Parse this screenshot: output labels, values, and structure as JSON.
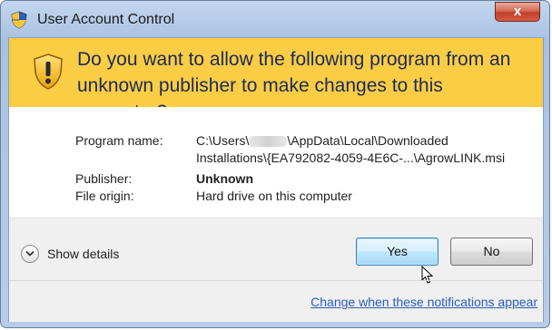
{
  "window": {
    "title": "User Account Control",
    "close_label": "x"
  },
  "banner": {
    "question": "Do you want to allow the following program from an unknown publisher to make changes to this computer?"
  },
  "details": {
    "program_name_label": "Program name:",
    "program_path_line1_prefix": "C:\\Users\\",
    "program_path_line1_suffix": "\\AppData\\Local\\Downloaded",
    "program_path_line2": "Installations\\{EA792082-4059-4E6C-...\\AgrowLINK.msi",
    "publisher_label": "Publisher:",
    "publisher_value": "Unknown",
    "file_origin_label": "File origin:",
    "file_origin_value": "Hard drive on this computer"
  },
  "footer": {
    "show_details_label": "Show details",
    "yes_label": "Yes",
    "no_label": "No",
    "notifications_link": "Change when these notifications appear"
  },
  "colors": {
    "banner": "#fbcd44",
    "question_text": "#1c2a56",
    "link": "#2a5cb8",
    "close_button": "#c2402a"
  },
  "icons": {
    "title": "uac-shield-icon",
    "banner": "warning-shield-icon",
    "toggle": "chevron-down-icon",
    "cursor": "mouse-pointer-icon"
  }
}
